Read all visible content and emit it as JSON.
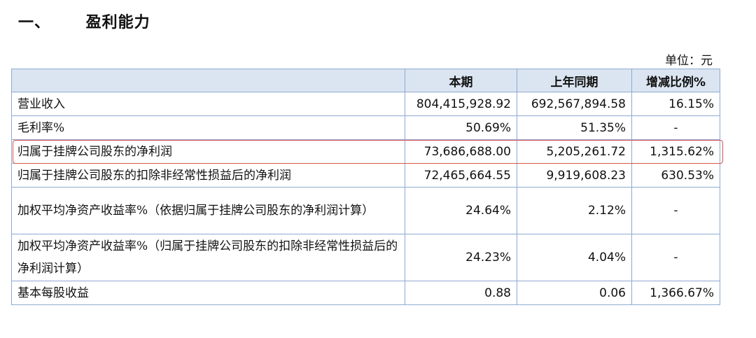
{
  "heading": {
    "number": "一、",
    "title": "盈利能力"
  },
  "unit": "单位：元",
  "table": {
    "headers": [
      "",
      "本期",
      "上年同期",
      "增减比例%"
    ],
    "rows": [
      {
        "label": "营业收入",
        "current": "804,415,928.92",
        "prior": "692,567,894.58",
        "change": "16.15%"
      },
      {
        "label": "毛利率%",
        "current": "50.69%",
        "prior": "51.35%",
        "change": "-"
      },
      {
        "label": "归属于挂牌公司股东的净利润",
        "current": "73,686,688.00",
        "prior": "5,205,261.72",
        "change": "1,315.62%"
      },
      {
        "label": "归属于挂牌公司股东的扣除非经常性损益后的净利润",
        "current": "72,465,664.55",
        "prior": "9,919,608.23",
        "change": "630.53%"
      },
      {
        "label": "加权平均净资产收益率%（依据归属于挂牌公司股东的净利润计算）",
        "current": "24.64%",
        "prior": "2.12%",
        "change": "-"
      },
      {
        "label": "加权平均净资产收益率%（归属于挂牌公司股东的扣除非经常性损益后的净利润计算）",
        "current": "24.23%",
        "prior": "4.04%",
        "change": "-"
      },
      {
        "label": "基本每股收益",
        "current": "0.88",
        "prior": "0.06",
        "change": "1,366.67%"
      }
    ]
  },
  "colors": {
    "header_bg": "#dbe5f1",
    "border": "#8eaad1",
    "highlight": "#d9534f"
  }
}
